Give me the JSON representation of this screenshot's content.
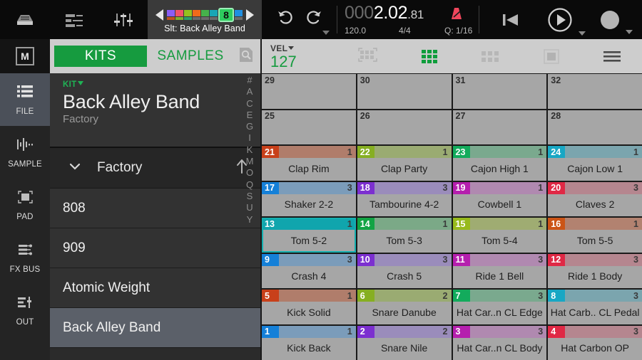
{
  "topbar": {
    "icons": [
      {
        "name": "browser-tray-icon",
        "label": "Browser"
      },
      {
        "name": "mixer-icon",
        "label": "Mixer"
      },
      {
        "name": "faders-icon",
        "label": "Faders"
      }
    ],
    "slot_selector": {
      "prev": "◀",
      "next": "▶",
      "selected": "8",
      "selected_color": "#2ecc5e",
      "label": "Slt: Back Alley Band",
      "chips": [
        {
          "top": "#8b5cf6",
          "bottom": "#c0521f"
        },
        {
          "top": "#f05268",
          "bottom": "#7fb02e"
        },
        {
          "top": "#95c11f",
          "bottom": "#2aa06a"
        },
        {
          "top": "#f06a1a",
          "bottom": "#6b6b6b"
        },
        {
          "top": "#46b24b",
          "bottom": "#6b6b6b"
        },
        {
          "top": "#19a6b5",
          "bottom": "#6b6b6b"
        },
        {
          "top": "#1f8fe0",
          "bottom": "#6b6b6b"
        }
      ]
    },
    "undo": {
      "name": "undo-icon"
    },
    "redo": {
      "name": "redo-icon"
    },
    "time": {
      "leading_zeros": "000",
      "bars_beats": "2.02",
      "ticks": ".81",
      "tempo": "120.0",
      "signature": "4/4",
      "quantize": "Q: 1/16"
    },
    "transport": {
      "rewind": "rewind-to-start",
      "play": "play",
      "record": "record"
    }
  },
  "bar2": {
    "m_button": "M",
    "tabs": [
      {
        "label": "KITS",
        "active": true
      },
      {
        "label": "SAMPLES",
        "active": false
      }
    ],
    "search_icon": "search-icon",
    "velocity": {
      "label": "VEL",
      "value": "127"
    },
    "view_icons": [
      {
        "name": "grid-select-icon",
        "active": false
      },
      {
        "name": "grid-4x4-icon",
        "active": true
      },
      {
        "name": "grid-3x2-icon",
        "active": false
      },
      {
        "name": "single-pad-icon",
        "active": false
      },
      {
        "name": "menu-icon",
        "active": false
      }
    ]
  },
  "leftnav": {
    "items": [
      {
        "label": "FILE",
        "icon": "list-icon",
        "active": true
      },
      {
        "label": "SAMPLE",
        "icon": "waveform-icon",
        "active": false
      },
      {
        "label": "PAD",
        "icon": "pad-icon",
        "active": false
      },
      {
        "label": "FX BUS",
        "icon": "fx-bus-icon",
        "active": false
      },
      {
        "label": "OUT",
        "icon": "out-icon",
        "active": false
      }
    ]
  },
  "browser": {
    "kit_tag": "KIT",
    "kit_name": "Back Alley Band",
    "kit_source": "Factory",
    "folder": "Factory",
    "folder_chevron": "chevron-down-icon",
    "folder_up": "arrow-up-icon",
    "items": [
      {
        "label": "808",
        "selected": false
      },
      {
        "label": "909",
        "selected": false
      },
      {
        "label": "Atomic Weight",
        "selected": false
      },
      {
        "label": "Back Alley Band",
        "selected": true
      }
    ],
    "alpha_index": [
      "#",
      "A",
      "C",
      "E",
      "G",
      "I",
      "K",
      "M",
      "O",
      "Q",
      "S",
      "U",
      "Y"
    ]
  },
  "pads": {
    "rows": [
      [
        {
          "num": "29",
          "name": "",
          "count": "",
          "empty": true
        },
        {
          "num": "30",
          "name": "",
          "count": "",
          "empty": true
        },
        {
          "num": "31",
          "name": "",
          "count": "",
          "empty": true
        },
        {
          "num": "32",
          "name": "",
          "count": "",
          "empty": true
        }
      ],
      [
        {
          "num": "25",
          "name": "",
          "count": "",
          "empty": true
        },
        {
          "num": "26",
          "name": "",
          "count": "",
          "empty": true
        },
        {
          "num": "27",
          "name": "",
          "count": "",
          "empty": true
        },
        {
          "num": "28",
          "name": "",
          "count": "",
          "empty": true
        }
      ],
      [
        {
          "num": "21",
          "name": "Clap Rim",
          "count": "1",
          "color": "#c8401a",
          "strip": "#b07d6b"
        },
        {
          "num": "22",
          "name": "Clap Party",
          "count": "1",
          "color": "#86af22",
          "strip": "#9aab72"
        },
        {
          "num": "23",
          "name": "Cajon High 1",
          "count": "1",
          "color": "#13ab5c",
          "strip": "#7aa98e"
        },
        {
          "num": "24",
          "name": "Cajon Low 1",
          "count": "1",
          "color": "#18a7c4",
          "strip": "#7ba5ae"
        }
      ],
      [
        {
          "num": "17",
          "name": "Shaker 2-2",
          "count": "3",
          "color": "#1580d8",
          "strip": "#7b9cba"
        },
        {
          "num": "18",
          "name": "Tambourine 4-2",
          "count": "3",
          "color": "#7c2fd0",
          "strip": "#9a8cbb"
        },
        {
          "num": "19",
          "name": "Cowbell 1",
          "count": "1",
          "color": "#b51fae",
          "strip": "#b089b0"
        },
        {
          "num": "20",
          "name": "Claves 2",
          "count": "3",
          "color": "#e02845",
          "strip": "#b5868f"
        }
      ],
      [
        {
          "num": "13",
          "name": "Tom 5-2",
          "count": "1",
          "color": "#10a5ad",
          "strip": "#10a5ad",
          "selected": true
        },
        {
          "num": "14",
          "name": "Tom 5-3",
          "count": "1",
          "color": "#12a444",
          "strip": "#7ba987"
        },
        {
          "num": "15",
          "name": "Tom 5-4",
          "count": "1",
          "color": "#97ba1d",
          "strip": "#9fac72"
        },
        {
          "num": "16",
          "name": "Tom 5-5",
          "count": "1",
          "color": "#cc5416",
          "strip": "#b28270"
        }
      ],
      [
        {
          "num": "9",
          "name": "Crash 4",
          "count": "3",
          "color": "#1580d8",
          "strip": "#7b9cba"
        },
        {
          "num": "10",
          "name": "Crash 5",
          "count": "3",
          "color": "#7c2fd0",
          "strip": "#9a8cbb"
        },
        {
          "num": "11",
          "name": "Ride 1 Bell",
          "count": "3",
          "color": "#b51fae",
          "strip": "#b089b0"
        },
        {
          "num": "12",
          "name": "Ride 1 Body",
          "count": "3",
          "color": "#e02845",
          "strip": "#b5868f"
        }
      ],
      [
        {
          "num": "5",
          "name": "Kick Solid",
          "count": "1",
          "color": "#c8401a",
          "strip": "#b07d6b"
        },
        {
          "num": "6",
          "name": "Snare Danube",
          "count": "2",
          "color": "#86af22",
          "strip": "#9aab72"
        },
        {
          "num": "7",
          "name": "Hat Car..n CL Edge",
          "count": "3",
          "color": "#13ab5c",
          "strip": "#7aa98e"
        },
        {
          "num": "8",
          "name": "Hat Carb.. CL Pedal",
          "count": "3",
          "color": "#18a7c4",
          "strip": "#7ba5ae"
        }
      ],
      [
        {
          "num": "1",
          "name": "Kick Back",
          "count": "1",
          "color": "#1580d8",
          "strip": "#7b9cba"
        },
        {
          "num": "2",
          "name": "Snare Nile",
          "count": "2",
          "color": "#7c2fd0",
          "strip": "#9a8cbb"
        },
        {
          "num": "3",
          "name": "Hat Car..n CL Body",
          "count": "3",
          "color": "#b51fae",
          "strip": "#b089b0"
        },
        {
          "num": "4",
          "name": "Hat Carbon OP",
          "count": "3",
          "color": "#e02845",
          "strip": "#b5868f"
        }
      ]
    ]
  }
}
